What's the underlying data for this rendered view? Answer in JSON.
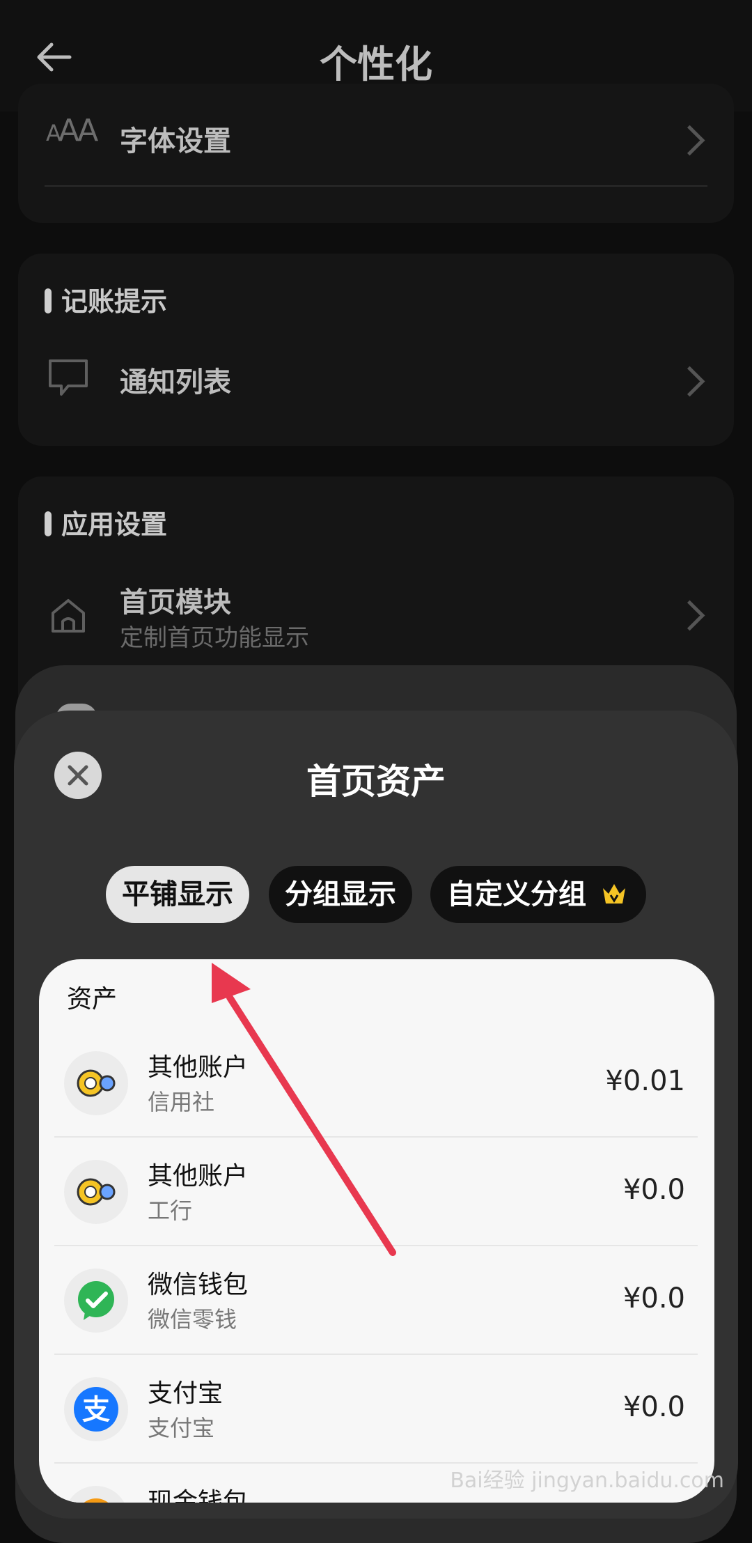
{
  "header": {
    "title": "个性化"
  },
  "font_row": {
    "label": "字体设置",
    "icon_text": "AA"
  },
  "section_reminder": {
    "title": "记账提示",
    "row_label": "通知列表"
  },
  "section_app": {
    "title": "应用设置",
    "row_label": "首页模块",
    "row_sub": "定制首页功能显示"
  },
  "sheet": {
    "title": "首页资产",
    "tabs": [
      "平铺显示",
      "分组显示",
      "自定义分组"
    ],
    "section_label": "资产",
    "accounts": [
      {
        "name": "其他账户",
        "sub": "信用社",
        "amount": "¥0.01",
        "icon": "other-account-icon"
      },
      {
        "name": "其他账户",
        "sub": "工行",
        "amount": "¥0.0",
        "icon": "other-account-icon"
      },
      {
        "name": "微信钱包",
        "sub": "微信零钱",
        "amount": "¥0.0",
        "icon": "wechat-icon"
      },
      {
        "name": "支付宝",
        "sub": "支付宝",
        "amount": "¥0.0",
        "icon": "alipay-icon"
      },
      {
        "name": "现金钱包",
        "sub": "",
        "amount": "",
        "icon": "cash-wallet-icon"
      }
    ]
  },
  "watermark": {
    "text": "Bai经验 jingyan.baidu.com"
  },
  "colors": {
    "accent_red": "#e8384f",
    "wechat_green": "#2fb556",
    "alipay_blue": "#1677ff",
    "account_yellow": "#f5c425"
  }
}
